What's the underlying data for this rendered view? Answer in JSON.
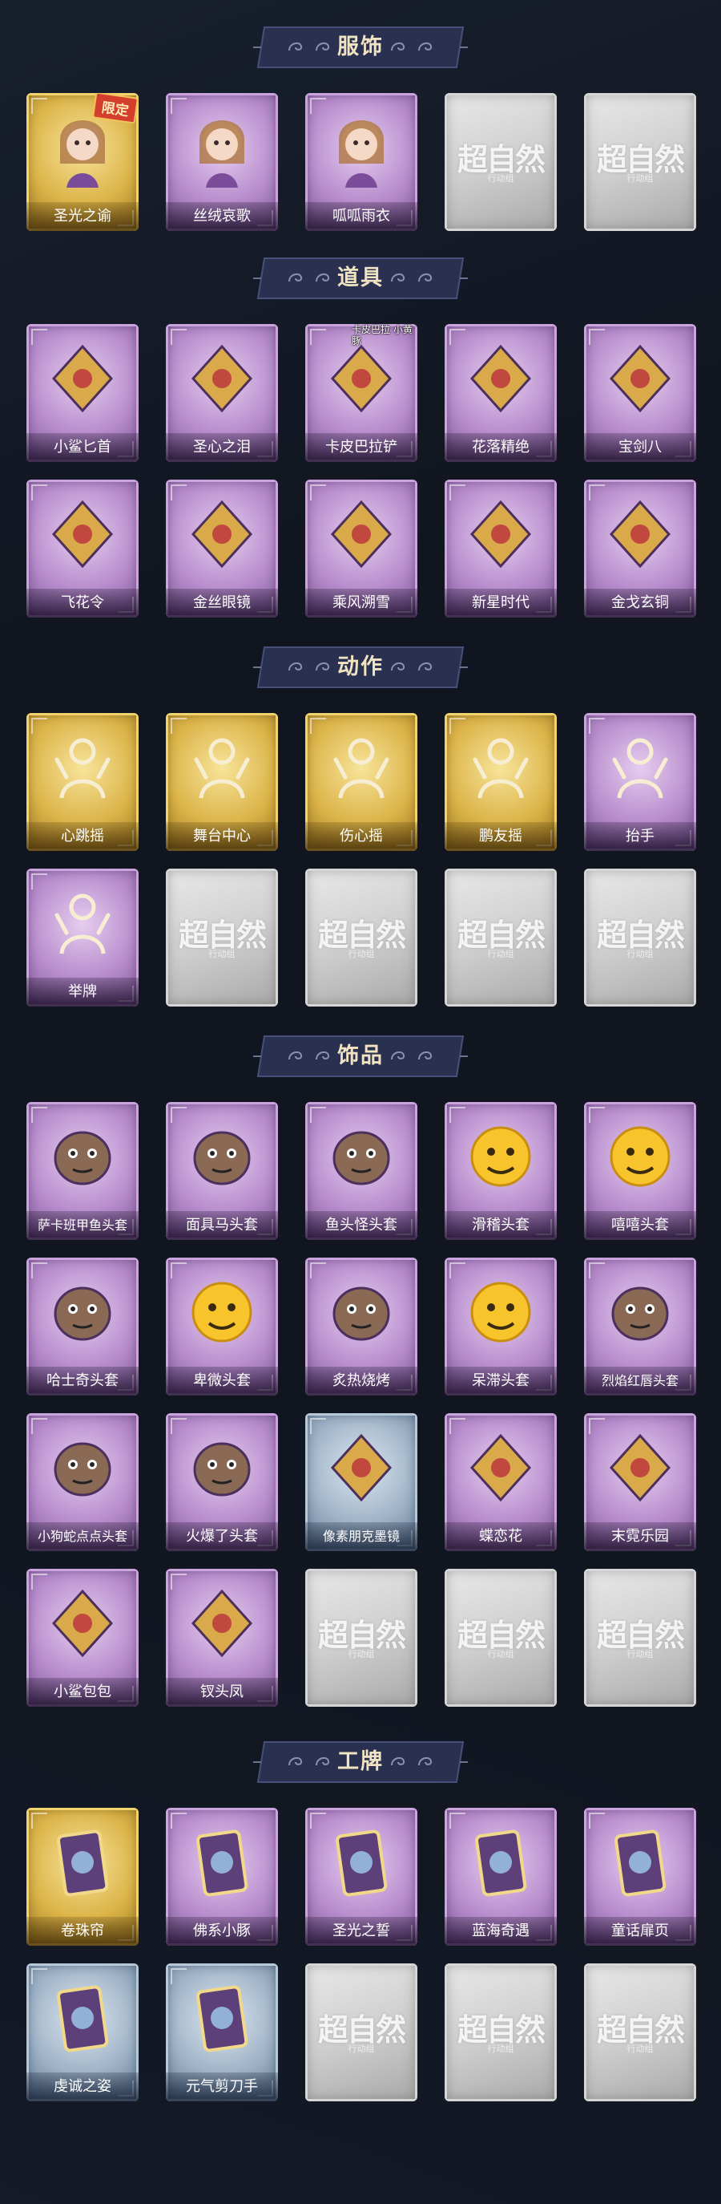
{
  "sections": [
    {
      "title": "服饰",
      "rows": [
        [
          {
            "label": "圣光之谕",
            "rarity": "gold",
            "icon": "saintess-portrait-icon",
            "badge": "限定"
          },
          {
            "label": "丝绒哀歌",
            "rarity": "purple",
            "icon": "doll-girl-portrait-icon"
          },
          {
            "label": "呱呱雨衣",
            "rarity": "purple",
            "icon": "frog-hat-girl-portrait-icon"
          },
          {
            "empty": true
          },
          {
            "empty": true
          }
        ]
      ]
    },
    {
      "title": "道具",
      "rows": [
        [
          {
            "label": "小鲨匕首",
            "rarity": "purple",
            "icon": "shark-dagger-icon"
          },
          {
            "label": "圣心之泪",
            "rarity": "purple",
            "icon": "heart-scepter-icon"
          },
          {
            "label": "卡皮巴拉铲",
            "rarity": "purple",
            "icon": "capybara-shovel-icon",
            "tag": "卡皮巴拉 小黄豚"
          },
          {
            "label": "花落精绝",
            "rarity": "purple",
            "icon": "flower-chain-icon"
          },
          {
            "label": "宝剑八",
            "rarity": "purple",
            "icon": "heart-mirror-icon"
          }
        ],
        [
          {
            "label": "飞花令",
            "rarity": "purple",
            "icon": "flower-lantern-icon"
          },
          {
            "label": "金丝眼镜",
            "rarity": "purple",
            "icon": "glasses-icon"
          },
          {
            "label": "乘风溯雪",
            "rarity": "purple",
            "icon": "jetpack-icon"
          },
          {
            "label": "新星时代",
            "rarity": "purple",
            "icon": "revolver-icon"
          },
          {
            "label": "金戈玄铜",
            "rarity": "purple",
            "icon": "grenade-icon"
          }
        ]
      ]
    },
    {
      "title": "动作",
      "rows": [
        [
          {
            "label": "心跳摇",
            "rarity": "gold",
            "icon": "gesture-heartbeat-icon"
          },
          {
            "label": "舞台中心",
            "rarity": "gold",
            "icon": "gesture-stage-icon"
          },
          {
            "label": "伤心摇",
            "rarity": "gold",
            "icon": "gesture-sad-icon"
          },
          {
            "label": "鹏友摇",
            "rarity": "gold",
            "icon": "gesture-friend-icon"
          },
          {
            "label": "抬手",
            "rarity": "purple",
            "icon": "gesture-raise-hand-icon"
          }
        ],
        [
          {
            "label": "举牌",
            "rarity": "purple",
            "icon": "gesture-hold-sign-icon"
          },
          {
            "empty": true
          },
          {
            "empty": true
          },
          {
            "empty": true
          },
          {
            "empty": true
          }
        ]
      ]
    },
    {
      "title": "饰品",
      "rows": [
        [
          {
            "label": "萨卡班甲鱼头套",
            "rarity": "purple",
            "icon": "fish-head-mask-icon",
            "small": true
          },
          {
            "label": "面具马头套",
            "rarity": "purple",
            "icon": "horse-head-mask-icon"
          },
          {
            "label": "鱼头怪头套",
            "rarity": "purple",
            "icon": "fishman-mask-icon"
          },
          {
            "label": "滑稽头套",
            "rarity": "purple",
            "icon": "smirk-emoji-mask-icon"
          },
          {
            "label": "嘻嘻头套",
            "rarity": "purple",
            "icon": "grin-emoji-mask-icon"
          }
        ],
        [
          {
            "label": "哈士奇头套",
            "rarity": "purple",
            "icon": "husky-mask-icon"
          },
          {
            "label": "卑微头套",
            "rarity": "purple",
            "icon": "humble-emoji-mask-icon"
          },
          {
            "label": "炙热烧烤",
            "rarity": "purple",
            "icon": "bbq-mask-icon"
          },
          {
            "label": "呆滞头套",
            "rarity": "purple",
            "icon": "dazed-emoji-mask-icon"
          },
          {
            "label": "烈焰红唇头套",
            "rarity": "purple",
            "icon": "pikachu-mask-icon",
            "small": true
          }
        ],
        [
          {
            "label": "小狗蛇点点头套",
            "rarity": "purple",
            "icon": "snake-mask-icon",
            "small": true
          },
          {
            "label": "火爆了头套",
            "rarity": "purple",
            "icon": "fire-mask-icon"
          },
          {
            "label": "像素朋克墨镜",
            "rarity": "blue",
            "icon": "pixel-sunglasses-icon",
            "small": true
          },
          {
            "label": "蝶恋花",
            "rarity": "purple",
            "icon": "butterfly-charm-icon"
          },
          {
            "label": "末霓乐园",
            "rarity": "purple",
            "icon": "clown-doll-icon"
          }
        ],
        [
          {
            "label": "小鲨包包",
            "rarity": "purple",
            "icon": "shark-bag-icon"
          },
          {
            "label": "钗头凤",
            "rarity": "purple",
            "icon": "phoenix-doll-icon"
          },
          {
            "empty": true
          },
          {
            "empty": true
          },
          {
            "empty": true
          }
        ]
      ]
    },
    {
      "title": "工牌",
      "rows": [
        [
          {
            "label": "卷珠帘",
            "rarity": "gold",
            "icon": "card-curtain-icon"
          },
          {
            "label": "佛系小豚",
            "rarity": "purple",
            "icon": "card-piglet-icon"
          },
          {
            "label": "圣光之誓",
            "rarity": "purple",
            "icon": "card-holy-icon"
          },
          {
            "label": "蓝海奇遇",
            "rarity": "purple",
            "icon": "card-ocean-icon"
          },
          {
            "label": "童话扉页",
            "rarity": "purple",
            "icon": "card-fairytale-icon"
          }
        ],
        [
          {
            "label": "虔诚之姿",
            "rarity": "blue",
            "icon": "card-devout-icon"
          },
          {
            "label": "元气剪刀手",
            "rarity": "blue",
            "icon": "card-peace-sign-icon"
          },
          {
            "empty": true
          },
          {
            "empty": true
          },
          {
            "empty": true
          }
        ]
      ]
    }
  ],
  "empty_card": {
    "logo": "超自然",
    "sub": "行动组"
  },
  "colors": {
    "gold": "#dcb449",
    "purple": "#b78ccc",
    "blue": "#9fb3c7",
    "empty": "#cfcfcf",
    "banner": "#2a3150",
    "background": "#10151f"
  }
}
